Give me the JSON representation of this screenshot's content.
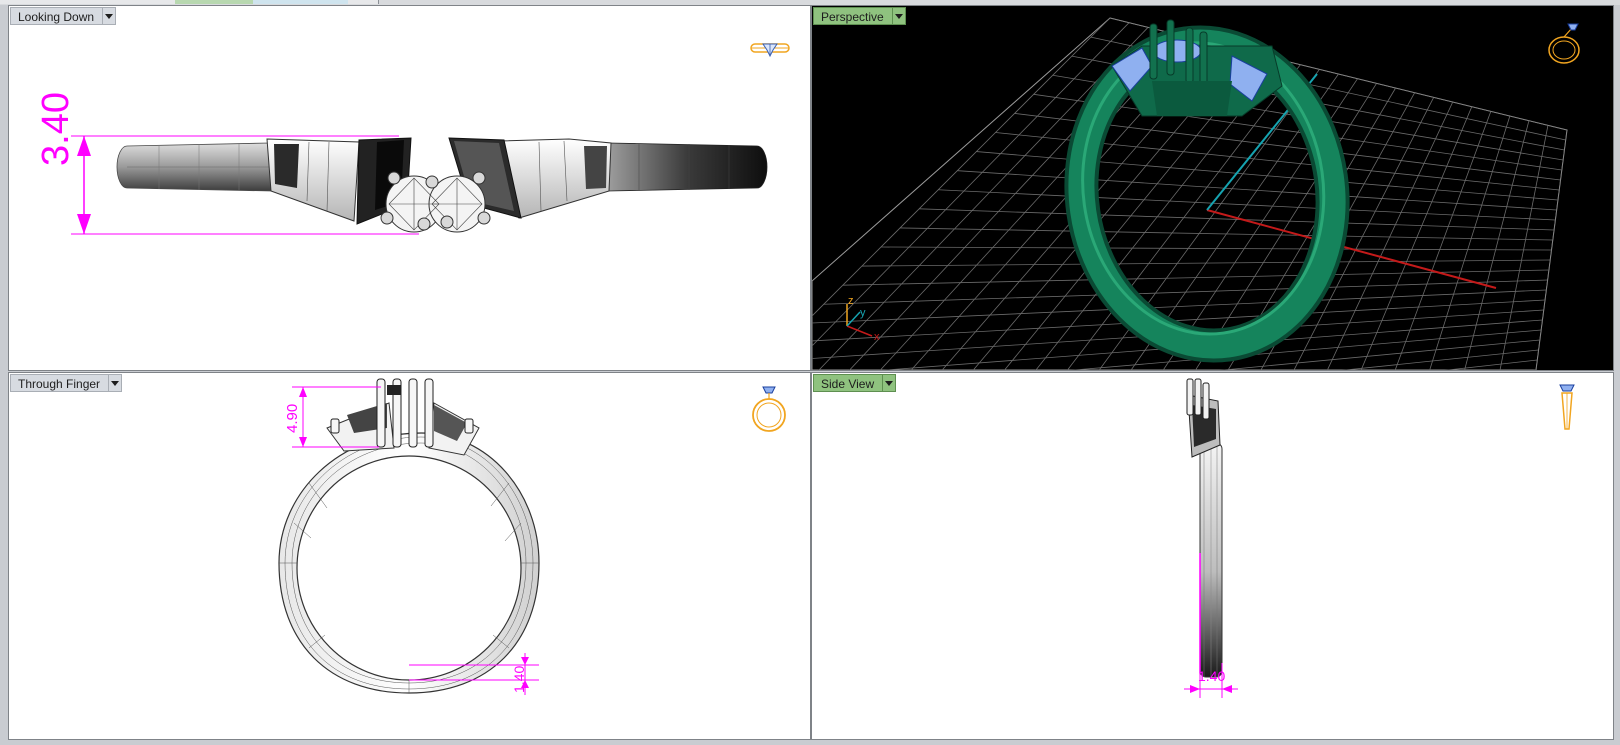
{
  "viewports": {
    "top_left": {
      "label": "Looking Down",
      "active": false,
      "icon": "ring-top-view-icon"
    },
    "top_right": {
      "label": "Perspective",
      "active": true,
      "icon": "ring-perspective-icon"
    },
    "bottom_left": {
      "label": "Through Finger",
      "active": false,
      "icon": "ring-front-view-icon"
    },
    "bottom_right": {
      "label": "Side View",
      "active": true,
      "icon": "ring-side-view-icon"
    }
  },
  "dimensions": {
    "looking_down_height": "3.40",
    "through_finger_head": "4.90",
    "through_finger_shank": "1.40",
    "side_view_width": "1.40"
  },
  "axes": {
    "x": "x",
    "y": "y",
    "z": "z"
  },
  "colors": {
    "active_label": "#8fc27f",
    "inactive_label": "#d7dbe1",
    "dimension": "#ff00ff",
    "ring_render": "#0f6a4a",
    "stone": "#8fb0f0",
    "grid": "#6a6a6a",
    "axis_x": "#c41a1a",
    "axis_y": "#16a3b0",
    "icon_gold": "#f1a520"
  }
}
